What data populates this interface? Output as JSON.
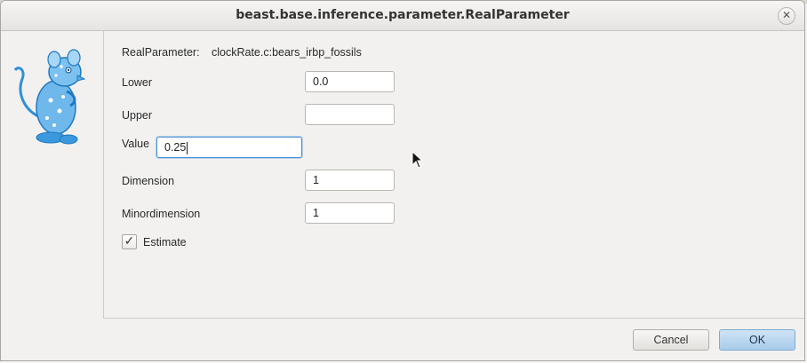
{
  "window": {
    "title": "beast.base.inference.parameter.RealParameter",
    "close_glyph": "✕"
  },
  "form": {
    "parameter_label": "RealParameter:",
    "parameter_id": "clockRate.c:bears_irbp_fossils",
    "lower_label": "Lower",
    "lower_value": "0.0",
    "upper_label": "Upper",
    "upper_value": "",
    "value_label": "Value",
    "value_value": "0.25",
    "dimension_label": "Dimension",
    "dimension_value": "1",
    "minordimension_label": "Minordimension",
    "minordimension_value": "1",
    "estimate_label": "Estimate",
    "estimate_checked": true,
    "estimate_check_glyph": "✓"
  },
  "buttons": {
    "cancel_label": "Cancel",
    "ok_label": "OK"
  },
  "colors": {
    "accent": "#4a90d9",
    "logo": "#2f8fd8"
  },
  "icons": {
    "logo": "beast-rat-logo-icon",
    "close": "close-icon",
    "check": "checkmark-icon",
    "cursor": "mouse-pointer-icon"
  }
}
